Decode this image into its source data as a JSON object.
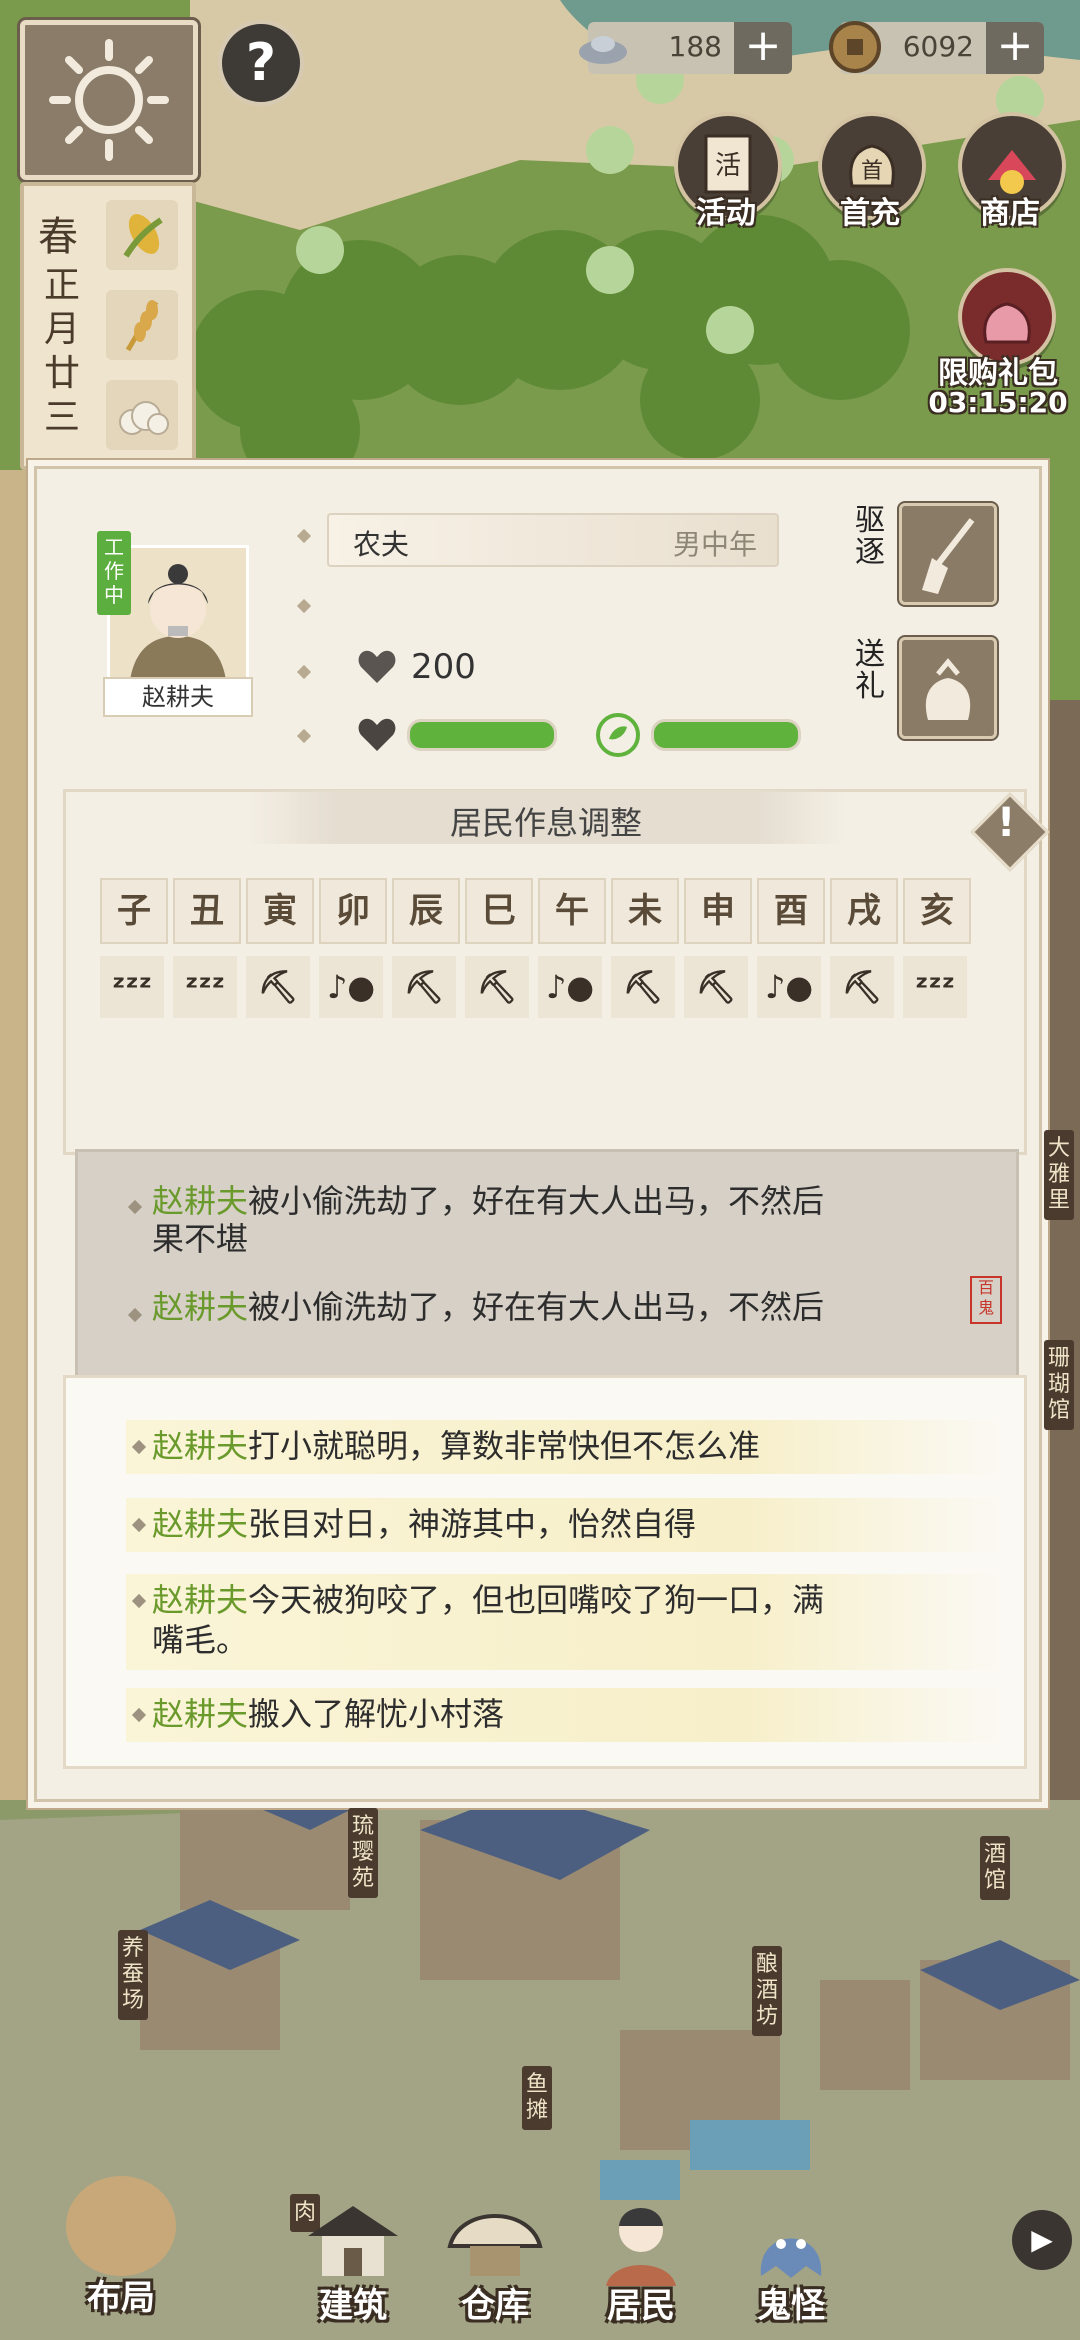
{
  "season": {
    "name": "春",
    "date": "正月廿三"
  },
  "currency": {
    "silver": "188",
    "coins": "6092",
    "add_label": "+"
  },
  "top_icons": {
    "activity": "活动",
    "first_charge": "首充",
    "shop": "商店",
    "limited_gift": "限购礼包",
    "gift_timer": "03:15:20"
  },
  "help_label": "?",
  "resident": {
    "status": "工作中",
    "name": "赵耕夫",
    "job": "农夫",
    "type": "男中年",
    "stat_value": "200",
    "expel_label": "驱逐",
    "gift_label": "送礼",
    "health_fill": 1.0,
    "mood_fill": 1.0
  },
  "schedule": {
    "title": "居民作息调整",
    "warn_label": "!",
    "hours": [
      "子",
      "丑",
      "寅",
      "卯",
      "辰",
      "巳",
      "午",
      "未",
      "申",
      "酉",
      "戌",
      "亥"
    ],
    "activities": [
      "sleep-icon",
      "sleep-icon",
      "pickaxe-icon",
      "music-person-icon",
      "pickaxe-icon",
      "pickaxe-icon",
      "music-person-icon",
      "pickaxe-icon",
      "pickaxe-icon",
      "music-person-icon",
      "pickaxe-icon",
      "sleep-icon"
    ],
    "activity_glyphs": {
      "sleep-icon": "ᶻᶻᶻ",
      "pickaxe-icon": "⛏",
      "music-person-icon": "♪●"
    }
  },
  "events": [
    {
      "name": "赵耕夫",
      "text": "被小偷洗劫了，好在有大人出马，不然后",
      "text2": "果不堪"
    },
    {
      "name": "赵耕夫",
      "text": "被小偷洗劫了，好在有大人出马，不然后"
    }
  ],
  "events_seal": "百鬼",
  "bio": [
    {
      "name": "赵耕夫",
      "text": "打小就聪明，算数非常快但不怎么准"
    },
    {
      "name": "赵耕夫",
      "text": "张目对日，神游其中，怡然自得"
    },
    {
      "name": "赵耕夫",
      "text": "今天被狗咬了，但也回嘴咬了狗一口，满",
      "text2": "嘴毛。"
    },
    {
      "name": "赵耕夫",
      "text": "搬入了解忧小村落"
    }
  ],
  "map_signs": {
    "dayali": "大雅里",
    "shanhuguan": "珊瑚馆",
    "liuyingyuan": "琉璎苑",
    "yangcanchang": "养蚕场",
    "niangjiufang": "酿酒坊",
    "jiuguan": "酒馆",
    "yutan": "鱼摊",
    "rou": "肉"
  },
  "nav": {
    "layout": "布局",
    "build": "建筑",
    "warehouse": "仓库",
    "residents": "居民",
    "ghosts": "鬼怪",
    "more": "▶"
  }
}
